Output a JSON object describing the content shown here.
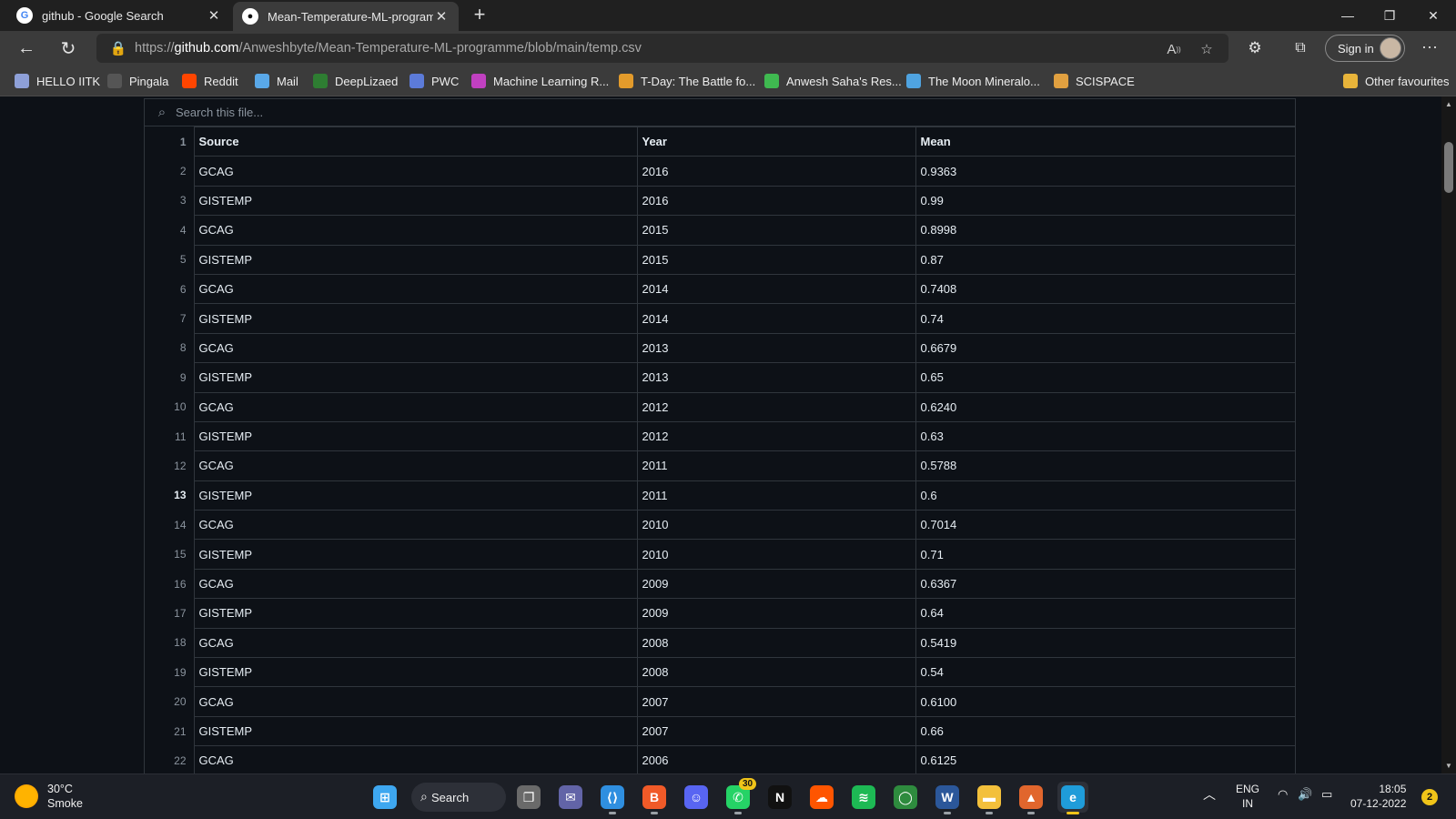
{
  "browser": {
    "tabs": [
      {
        "title": "github - Google Search",
        "favicon": "google-icon",
        "active": false
      },
      {
        "title": "Mean-Temperature-ML-programme/blob/main/temp.csv",
        "favicon": "github-icon",
        "active": true
      }
    ],
    "url_prefix": "https://",
    "url_domain": "github.com",
    "url_path": "/Anweshbyte/Mean-Temperature-ML-programme/blob/main/temp.csv",
    "sign_in_label": "Sign in"
  },
  "favorites": [
    {
      "label": "HELLO IITK",
      "icon": "hello-iitk-icon",
      "color": "#8ea0d8"
    },
    {
      "label": "Pingala",
      "icon": "pingala-icon",
      "color": "#555555"
    },
    {
      "label": "Reddit",
      "icon": "reddit-icon",
      "color": "#ff4500"
    },
    {
      "label": "Mail",
      "icon": "mail-icon",
      "color": "#59a8e8"
    },
    {
      "label": "DeepLizaed",
      "icon": "deeplizaed-icon",
      "color": "#2e7d32"
    },
    {
      "label": "PWC",
      "icon": "pwc-icon",
      "color": "#5c7bd9"
    },
    {
      "label": "Machine Learning R...",
      "icon": "machine-learning-icon",
      "color": "#c040c0"
    },
    {
      "label": "T-Day: The Battle fo...",
      "icon": "t-day-icon",
      "color": "#e39b2b"
    },
    {
      "label": "Anwesh Saha's Res...",
      "icon": "anwesh-icon",
      "color": "#3fb950"
    },
    {
      "label": "The Moon Mineralo...",
      "icon": "moon-icon",
      "color": "#4fa3e0"
    },
    {
      "label": "SCISPACE",
      "icon": "scispace-icon",
      "color": "#e0a040"
    }
  ],
  "other_favourites_label": "Other favourites",
  "file": {
    "search_placeholder": "Search this file...",
    "header": {
      "line": "1",
      "cols": [
        "Source",
        "Year",
        "Mean"
      ]
    },
    "active_line": 13,
    "rows": [
      {
        "line": "2",
        "source": "GCAG",
        "year": "2016",
        "mean": "0.9363"
      },
      {
        "line": "3",
        "source": "GISTEMP",
        "year": "2016",
        "mean": "0.99"
      },
      {
        "line": "4",
        "source": "GCAG",
        "year": "2015",
        "mean": "0.8998"
      },
      {
        "line": "5",
        "source": "GISTEMP",
        "year": "2015",
        "mean": "0.87"
      },
      {
        "line": "6",
        "source": "GCAG",
        "year": "2014",
        "mean": "0.7408"
      },
      {
        "line": "7",
        "source": "GISTEMP",
        "year": "2014",
        "mean": "0.74"
      },
      {
        "line": "8",
        "source": "GCAG",
        "year": "2013",
        "mean": "0.6679"
      },
      {
        "line": "9",
        "source": "GISTEMP",
        "year": "2013",
        "mean": "0.65"
      },
      {
        "line": "10",
        "source": "GCAG",
        "year": "2012",
        "mean": "0.6240"
      },
      {
        "line": "11",
        "source": "GISTEMP",
        "year": "2012",
        "mean": "0.63"
      },
      {
        "line": "12",
        "source": "GCAG",
        "year": "2011",
        "mean": "0.5788"
      },
      {
        "line": "13",
        "source": "GISTEMP",
        "year": "2011",
        "mean": "0.6"
      },
      {
        "line": "14",
        "source": "GCAG",
        "year": "2010",
        "mean": "0.7014"
      },
      {
        "line": "15",
        "source": "GISTEMP",
        "year": "2010",
        "mean": "0.71"
      },
      {
        "line": "16",
        "source": "GCAG",
        "year": "2009",
        "mean": "0.6367"
      },
      {
        "line": "17",
        "source": "GISTEMP",
        "year": "2009",
        "mean": "0.64"
      },
      {
        "line": "18",
        "source": "GCAG",
        "year": "2008",
        "mean": "0.5419"
      },
      {
        "line": "19",
        "source": "GISTEMP",
        "year": "2008",
        "mean": "0.54"
      },
      {
        "line": "20",
        "source": "GCAG",
        "year": "2007",
        "mean": "0.6100"
      },
      {
        "line": "21",
        "source": "GISTEMP",
        "year": "2007",
        "mean": "0.66"
      },
      {
        "line": "22",
        "source": "GCAG",
        "year": "2006",
        "mean": "0.6125"
      }
    ]
  },
  "taskbar": {
    "weather_temp": "30°C",
    "weather_desc": "Smoke",
    "search_label": "Search",
    "whatsapp_badge": "30",
    "apps": [
      {
        "name": "start-icon",
        "color": "#3ea7f0",
        "glyph": "⊞"
      },
      {
        "name": "task-view-icon",
        "color": "#6a6a6a",
        "glyph": "❐"
      },
      {
        "name": "teams-chat-icon",
        "color": "#6264a7",
        "glyph": "✉"
      },
      {
        "name": "vscode-icon",
        "color": "#2f8fe0",
        "glyph": "⟨⟩"
      },
      {
        "name": "brave-icon",
        "color": "#f05a28",
        "glyph": "B"
      },
      {
        "name": "discord-icon",
        "color": "#5865f2",
        "glyph": "☺"
      },
      {
        "name": "whatsapp-icon",
        "color": "#25d366",
        "glyph": "✆"
      },
      {
        "name": "netflix-icon",
        "color": "#111111",
        "glyph": "N"
      },
      {
        "name": "soundcloud-icon",
        "color": "#ff5500",
        "glyph": "☁"
      },
      {
        "name": "spotify-icon",
        "color": "#1db954",
        "glyph": "≋"
      },
      {
        "name": "refresh-app-icon",
        "color": "#2e8b3e",
        "glyph": "◯"
      },
      {
        "name": "word-icon",
        "color": "#2b579a",
        "glyph": "W"
      },
      {
        "name": "file-explorer-icon",
        "color": "#f3c03b",
        "glyph": "▬"
      },
      {
        "name": "matlab-icon",
        "color": "#e1662d",
        "glyph": "▲"
      },
      {
        "name": "edge-icon",
        "color": "#1f9cd9",
        "glyph": "e"
      }
    ],
    "lang_top": "ENG",
    "lang_bottom": "IN",
    "time": "18:05",
    "date": "07-12-2022",
    "notification_count": "2"
  }
}
